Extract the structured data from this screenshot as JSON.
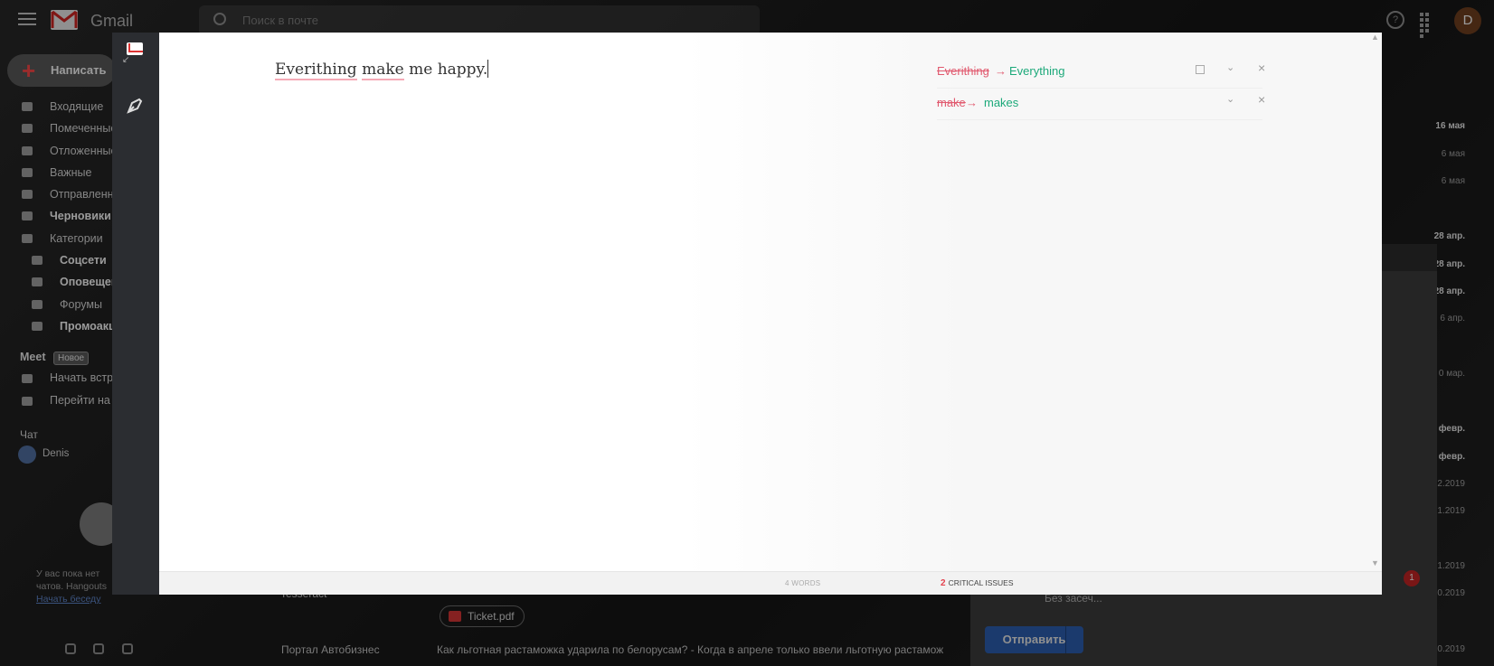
{
  "gmail": {
    "app_title": "Gmail",
    "search_placeholder": "Поиск в почте",
    "avatar_letter": "D",
    "compose_label": "Написать",
    "nav": [
      {
        "label": "Входящие",
        "bold": true
      },
      {
        "label": "Помеченные",
        "bold": false
      },
      {
        "label": "Отложенные",
        "bold": false
      },
      {
        "label": "Важные",
        "bold": false
      },
      {
        "label": "Отправленные",
        "bold": false
      },
      {
        "label": "Черновики",
        "bold": true
      },
      {
        "label": "Категории",
        "bold": false
      },
      {
        "label": "Соцсети",
        "bold": true
      },
      {
        "label": "Оповещения",
        "bold": true
      },
      {
        "label": "Форумы",
        "bold": false
      },
      {
        "label": "Промоакции",
        "bold": true
      }
    ],
    "meet": {
      "title": "Meet",
      "badge": "Новое",
      "start": "Начать встречу",
      "join": "Перейти на встречу"
    },
    "chat": {
      "title": "Чат",
      "user": "Denis",
      "empty_text": "У вас пока нет чатов. Hangouts",
      "empty_link": "Начать беседу"
    },
    "dates": [
      "16 мая",
      "6 мая",
      "6 мая",
      "28 апр.",
      "28 апр.",
      "28 апр.",
      "6 апр.",
      "0 мар.",
      "февр.",
      "февр.",
      "2.2019",
      "1.2019",
      "1.2019",
      "0.2019",
      "0.2019"
    ],
    "rows": [
      {
        "sender": "Tesseract",
        "subject": ""
      },
      {
        "sender": "Портал Автобизнес",
        "subject": "Как льготная растаможка ударила по белорусам? - Когда в апреле только ввели льготную растамож"
      }
    ],
    "attachment": "Ticket.pdf",
    "compose_toolbar_font": "Без засеч...",
    "send_label": "Отправить",
    "notification_count": "1"
  },
  "grammarly": {
    "document_text": {
      "w1": "Everithing",
      "w2": "make",
      "rest": " me happy."
    },
    "suggestions": [
      {
        "from": "Everithing",
        "to": "Everything"
      },
      {
        "from": "make",
        "to": "makes"
      }
    ],
    "footer": {
      "words": "4 WORDS",
      "issues_count": "2",
      "issues_label": "CRITICAL ISSUES"
    }
  }
}
